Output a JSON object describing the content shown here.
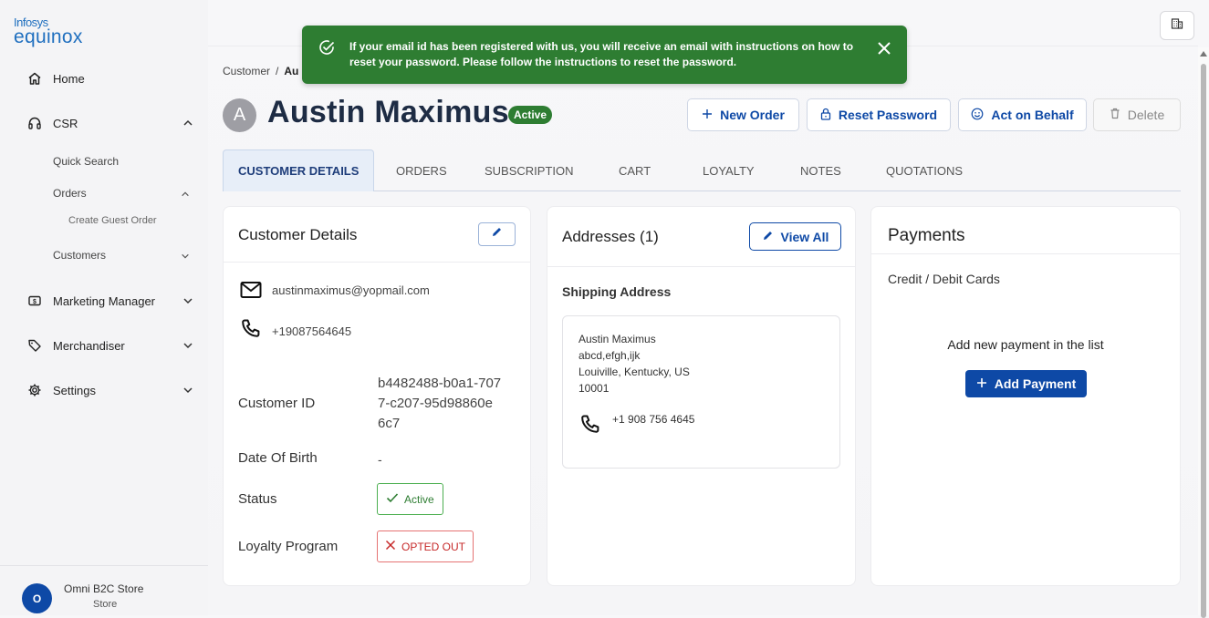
{
  "brand": {
    "line1": "Infosys",
    "line2": "equinox"
  },
  "sidebar": {
    "items": [
      {
        "label": "Home",
        "icon": "home-icon"
      },
      {
        "label": "CSR",
        "icon": "headset-icon"
      },
      {
        "label": "Marketing Manager",
        "icon": "dollar-icon"
      },
      {
        "label": "Merchandiser",
        "icon": "tag-icon"
      },
      {
        "label": "Settings",
        "icon": "gear-icon"
      }
    ],
    "csr_sub": {
      "quick_search": "Quick Search",
      "orders": "Orders",
      "create_guest_order": "Create Guest Order",
      "customers": "Customers"
    },
    "store": {
      "initial": "O",
      "name": "Omni B2C Store",
      "type": "Store"
    }
  },
  "breadcrumb": {
    "root": "Customer",
    "separator": "/",
    "current": "Au"
  },
  "toast": {
    "message": "If your email id has been registered with us, you will receive an email with instructions on how to reset your password. Please follow the instructions to reset the password.",
    "color": "#2e7d32"
  },
  "customer": {
    "initial": "A",
    "name": "Austin Maximus",
    "status_badge": "Active"
  },
  "actions": {
    "new_order": "New Order",
    "reset_password": "Reset Password",
    "act_on_behalf": "Act on Behalf",
    "delete": "Delete"
  },
  "tabs": [
    "CUSTOMER DETAILS",
    "ORDERS",
    "SUBSCRIPTION",
    "CART",
    "LOYALTY",
    "NOTES",
    "QUOTATIONS"
  ],
  "details": {
    "title": "Customer Details",
    "email": "austinmaximus@yopmail.com",
    "phone": "+19087564645",
    "customer_id_label": "Customer ID",
    "customer_id_l1": "b4482488-b0a1-707",
    "customer_id_l2": "7-c207-95d98860e",
    "customer_id_l3": "6c7",
    "dob_label": "Date Of Birth",
    "dob": "-",
    "status_label": "Status",
    "status": "Active",
    "loyalty_label": "Loyalty Program",
    "loyalty": "OPTED OUT"
  },
  "addresses": {
    "title": "Addresses (1)",
    "view_all": "View All",
    "shipping_title": "Shipping Address",
    "name": "Austin Maximus",
    "line1": "abcd,efgh,ijk",
    "line2": "Louiville, Kentucky, US",
    "zip": "10001",
    "phone": "+1 908 756 4645"
  },
  "payments": {
    "title": "Payments",
    "cards_title": "Credit / Debit Cards",
    "empty_message": "Add new payment in the list",
    "add_button": "Add Payment"
  },
  "colors": {
    "primary": "#0e49a6",
    "success": "#2e7d32",
    "error": "#c62828"
  }
}
